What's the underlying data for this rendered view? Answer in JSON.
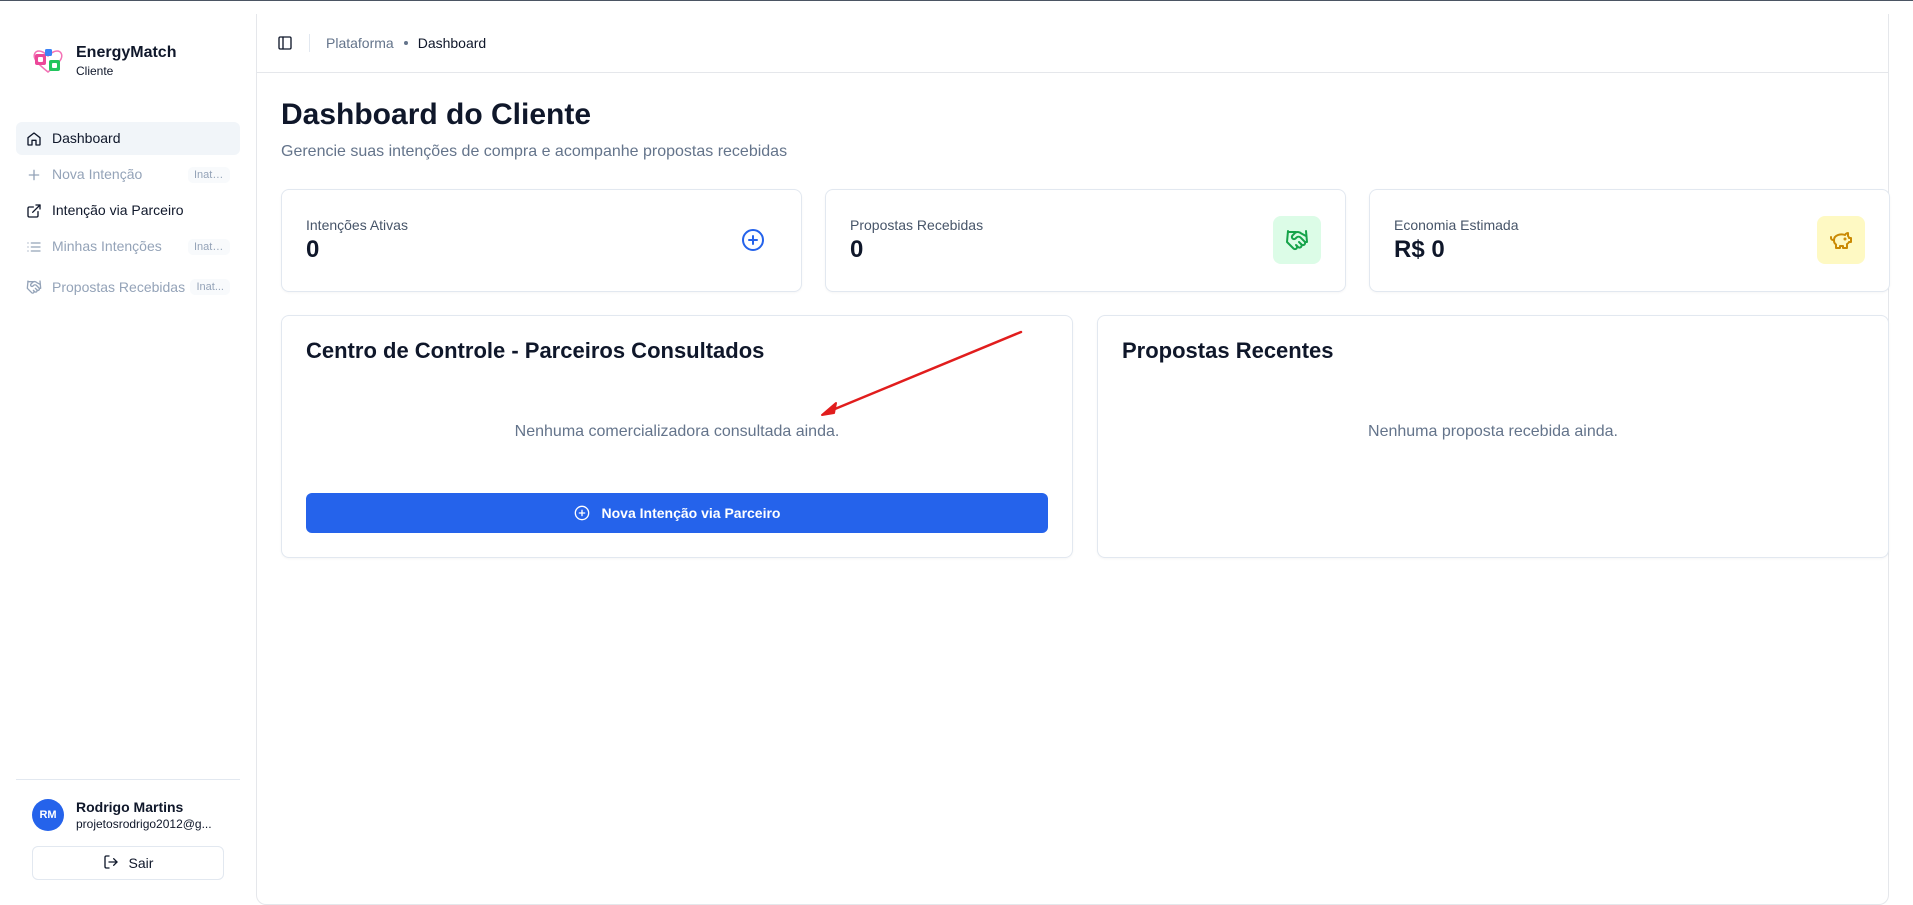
{
  "brand": {
    "name": "EnergyMatch",
    "role": "Cliente"
  },
  "sidebar": {
    "items": [
      {
        "label": "Dashboard",
        "icon": "home-icon",
        "badge": ""
      },
      {
        "label": "Nova Intenção",
        "icon": "plus-icon",
        "badge": "Inativo"
      },
      {
        "label": "Intenção via Parceiro",
        "icon": "external-link-icon",
        "badge": ""
      },
      {
        "label": "Minhas Intenções",
        "icon": "list-icon",
        "badge": "Inativo"
      },
      {
        "label": "Propostas Recebidas",
        "icon": "handshake-icon",
        "badge": "Inat..."
      }
    ]
  },
  "user": {
    "initials": "RM",
    "name": "Rodrigo Martins",
    "email": "projetosrodrigo2012@g...",
    "logout_label": "Sair"
  },
  "header": {
    "breadcrumb": [
      "Plataforma",
      "Dashboard"
    ]
  },
  "page": {
    "title": "Dashboard do Cliente",
    "subtitle": "Gerencie suas intenções de compra e acompanhe propostas recebidas"
  },
  "stats": [
    {
      "label": "Intenções Ativas",
      "value": "0",
      "icon": "plus-circle-icon",
      "color": "#2563eb"
    },
    {
      "label": "Propostas Recebidas",
      "value": "0",
      "icon": "handshake-icon",
      "color": "#16a34a"
    },
    {
      "label": "Economia Estimada",
      "value": "R$ 0",
      "icon": "piggy-bank-icon",
      "color": "#ca8a04"
    }
  ],
  "control_panel": {
    "title": "Centro de Controle - Parceiros Consultados",
    "empty_text": "Nenhuma comercializadora consultada ainda.",
    "button_label": "Nova Intenção via Parceiro"
  },
  "recent_panel": {
    "title": "Propostas Recentes",
    "empty_text": "Nenhuma proposta recebida ainda."
  },
  "colors": {
    "accent": "#2563eb",
    "annotation_arrow": "#e11d1d"
  }
}
